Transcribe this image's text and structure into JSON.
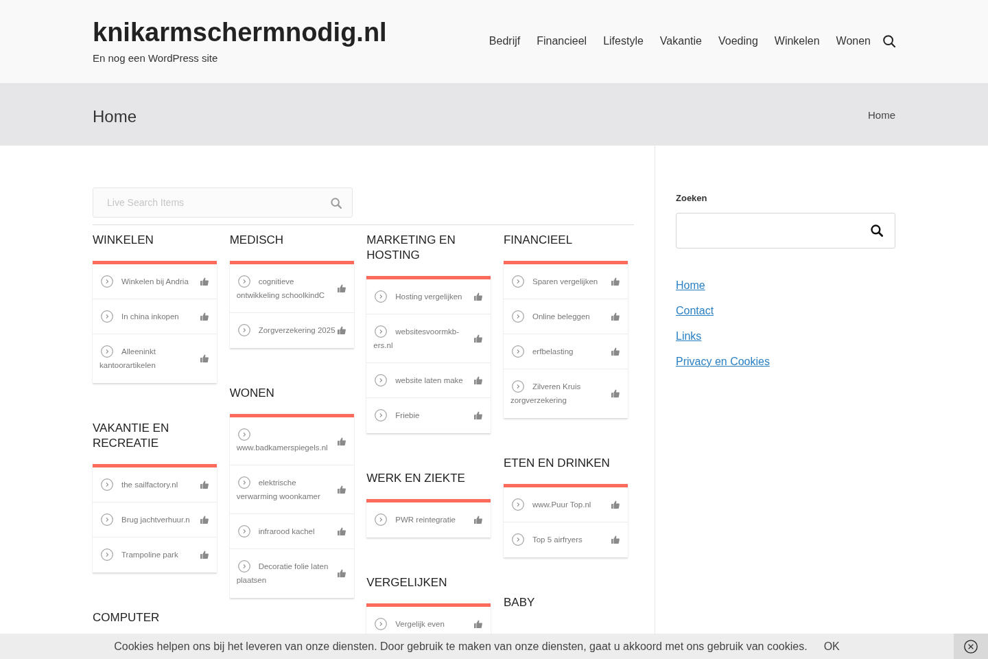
{
  "header": {
    "site_title": "knikarmschermnodig.nl",
    "tagline": "En nog een WordPress site",
    "nav": [
      "Bedrijf",
      "Financieel",
      "Lifestyle",
      "Vakantie",
      "Voeding",
      "Winkelen",
      "Wonen"
    ]
  },
  "page_title_bar": {
    "title": "Home",
    "breadcrumb": "Home"
  },
  "live_search": {
    "placeholder": "Live Search Items"
  },
  "columns": [
    {
      "sections": [
        {
          "heading": "WINKELEN",
          "items": [
            "Winkelen bij Andria",
            "In china inkopen",
            "Alleeninkt kantoorartikelen"
          ]
        },
        {
          "heading": "VAKANTIE EN RECREATIE",
          "items": [
            "the sailfactory.nl",
            "Brug jachtverhuur.n",
            "Trampoline park"
          ]
        },
        {
          "heading": "COMPUTER"
        }
      ]
    },
    {
      "sections": [
        {
          "heading": "MEDISCH",
          "items": [
            "cognitieve ontwikkeling schoolkindC",
            "Zorgverzekering 2025"
          ]
        },
        {
          "heading": "WONEN",
          "items": [
            "www.badkamerspiegels.nl",
            "elektrische verwarming woonkamer",
            "infrarood kachel",
            "Decoratie folie laten plaatsen"
          ]
        }
      ]
    },
    {
      "sections": [
        {
          "heading": "MARKETING EN HOSTING",
          "items": [
            "Hosting vergelijken",
            "websitesvoormkb-ers.nl",
            "website laten make",
            "Friebie"
          ]
        },
        {
          "heading": "WERK EN ZIEKTE",
          "items": [
            "PWR reintegratie"
          ]
        },
        {
          "heading": "VERGELIJKEN",
          "items": [
            "Vergelijk even"
          ]
        }
      ]
    },
    {
      "sections": [
        {
          "heading": "FINANCIEEL",
          "items": [
            "Sparen vergelijken",
            "Online beleggen",
            "erfbelasting",
            "Zilveren Kruis zorgverzekering"
          ]
        },
        {
          "heading": "ETEN EN DRINKEN",
          "items": [
            "www.Puur Top.nl",
            "Top 5 airfryers"
          ]
        },
        {
          "heading": "BABY"
        }
      ]
    }
  ],
  "sidebar": {
    "search_label": "Zoeken",
    "links": [
      "Home",
      "Contact",
      "Links",
      "Privacy en Cookies"
    ]
  },
  "cookie_bar": {
    "message": "Cookies helpen ons bij het leveren van onze diensten. Door gebruik te maken van onze diensten, gaat u akkoord met ons gebruik van cookies.",
    "ok": "OK"
  }
}
